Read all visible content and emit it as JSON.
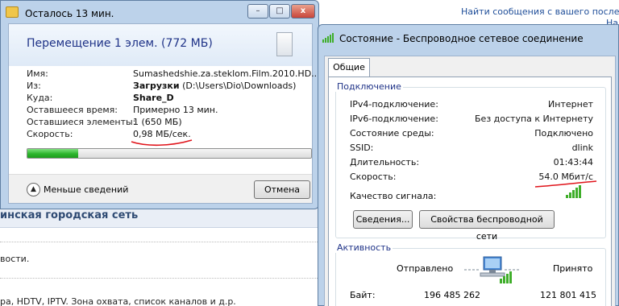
{
  "background_page": {
    "top_link": "Найти сообщения с вашего послед",
    "top_link_2": "На",
    "heading": "инская городская сеть",
    "line1": "вости.",
    "line2": "ра, HDTV, IPTV. Зона охвата, список каналов и д.р."
  },
  "copy_dialog": {
    "title": "Осталось 13 мин.",
    "header": "Перемещение 1 элем. (772 МБ)",
    "rows": [
      {
        "label": "Имя:",
        "value": "Sumashedshie.za.steklom.Film.2010.HD..."
      },
      {
        "label": "Из:",
        "value_bold": "Загрузки",
        "value": " (D:\\Users\\Dio\\Downloads)"
      },
      {
        "label": "Куда:",
        "value_bold": "Share_D",
        "value": ""
      },
      {
        "label": "Оставшееся время:",
        "value": "Примерно 13 мин."
      },
      {
        "label": "Оставшиеся элементы:",
        "value": "1 (650 МБ)"
      },
      {
        "label": "Скорость:",
        "value": "0,98 МБ/сек."
      }
    ],
    "progress_fraction": 0.18,
    "less_details_label": "Меньше сведений",
    "cancel_label": "Отмена",
    "min_btn": "–",
    "max_btn": "□",
    "close_btn": "x"
  },
  "status_window": {
    "title": "Состояние - Беспроводное сетевое соединение",
    "tab": "Общие",
    "connection_group": "Подключение",
    "rows": [
      {
        "label": "IPv4-подключение:",
        "value": "Интернет"
      },
      {
        "label": "IPv6-подключение:",
        "value": "Без доступа к Интернету"
      },
      {
        "label": "Состояние среды:",
        "value": "Подключено"
      },
      {
        "label": "SSID:",
        "value": "dlink"
      },
      {
        "label": "Длительность:",
        "value": "01:43:44"
      },
      {
        "label": "Скорость:",
        "value": "54.0 Мбит/с"
      }
    ],
    "signal_quality_label": "Качество сигнала:",
    "signal_level": 5,
    "details_btn": "Сведения...",
    "wireless_props_btn": "Свойства беспроводной сети",
    "activity_group": "Активность",
    "sent_label": "Отправлено",
    "received_label": "Принято",
    "bytes_label": "Байт:",
    "bytes_sent": "196 485 262",
    "bytes_received": "121 801 415"
  },
  "colors": {
    "annotation_red": "#e0141b",
    "progress_green": "#2db52d",
    "title_blue": "#1e3287"
  }
}
